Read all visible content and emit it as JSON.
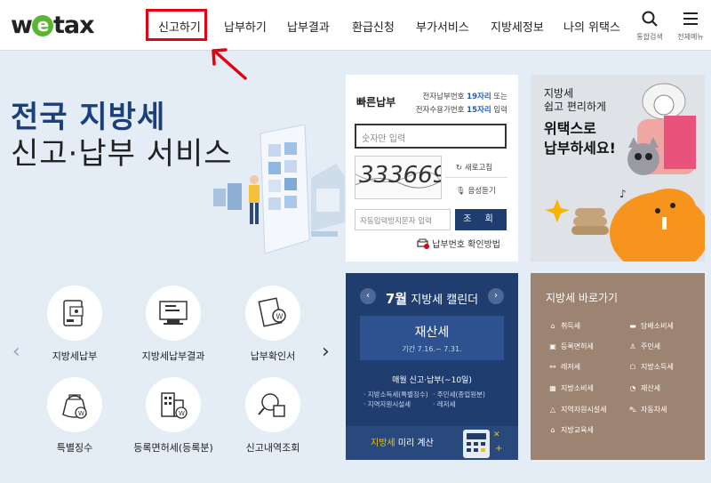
{
  "header": {
    "logo": {
      "prefix": "w",
      "e": "e",
      "suffix": "tax"
    },
    "nav": [
      "신고하기",
      "납부하기",
      "납부결과",
      "환급신청",
      "부가서비스",
      "지방세정보",
      "나의 위택스"
    ],
    "search_label": "통합검색",
    "menu_label": "전체메뉴"
  },
  "hero": {
    "title_line1": "전국 지방세",
    "title_line2": "신고·납부 서비스"
  },
  "quick_pay": {
    "title": "빠른납부",
    "info_line1_pre": "전자납부번호 ",
    "info_line1_hl": "19자리",
    "info_line1_post": " 또는",
    "info_line2_pre": "전자수용가번호 ",
    "info_line2_hl": "15자리",
    "info_line2_post": " 입력",
    "number_placeholder": "숫자만 입력",
    "captcha_text": "333669",
    "refresh_label": "새로고침",
    "audio_label": "음성듣기",
    "auto_placeholder": "자동입력방지문자 입력",
    "submit_label": "조 회",
    "confirm_link": "납부번호 확인방법"
  },
  "promo": {
    "line1": "지방세",
    "line2": "쉽고 편리하게",
    "line3": "위택스로",
    "line4": "납부하세요!"
  },
  "services": [
    {
      "label": "지방세납부",
      "icon": "tax-payment-icon"
    },
    {
      "label": "지방세납부결과",
      "icon": "payment-result-icon"
    },
    {
      "label": "납부확인서",
      "icon": "payment-certificate-icon"
    },
    {
      "label": "특별징수",
      "icon": "special-collection-icon"
    },
    {
      "label": "등록면허세(등록분)",
      "icon": "registration-license-icon"
    },
    {
      "label": "신고내역조회",
      "icon": "report-history-icon"
    }
  ],
  "calendar": {
    "month": "7월",
    "title": "지방세 캘린더",
    "prev": "‹",
    "next": "›",
    "tax_name": "재산세",
    "period": "기간 7.16.~ 7.31.",
    "monthly_title": "매월 신고·납부(~10일)",
    "items": [
      "지방소득세(특별징수)",
      "주민세(종업원분)",
      "지역자원시설세",
      "레저세"
    ],
    "calc_highlight": "지방세",
    "calc_rest": " 미리 계산"
  },
  "shortcuts": {
    "title": "지방세 바로가기",
    "items": [
      {
        "label": "취득세",
        "icon": "acquisition-tax-icon"
      },
      {
        "label": "담배소비세",
        "icon": "tobacco-tax-icon"
      },
      {
        "label": "등록면허세",
        "icon": "registration-tax-icon"
      },
      {
        "label": "주민세",
        "icon": "resident-tax-icon"
      },
      {
        "label": "레저세",
        "icon": "leisure-tax-icon"
      },
      {
        "label": "지방소득세",
        "icon": "income-tax-icon"
      },
      {
        "label": "지방소비세",
        "icon": "consumption-tax-icon"
      },
      {
        "label": "재산세",
        "icon": "property-tax-icon"
      },
      {
        "label": "지역자원시설세",
        "icon": "resource-tax-icon"
      },
      {
        "label": "자동차세",
        "icon": "vehicle-tax-icon"
      },
      {
        "label": "지방교육세",
        "icon": "education-tax-icon"
      }
    ]
  },
  "colors": {
    "brand_navy": "#1f3e6f",
    "brand_green": "#5cb531",
    "highlight_red": "#e60012",
    "shortcut_brown": "#9d8472"
  }
}
